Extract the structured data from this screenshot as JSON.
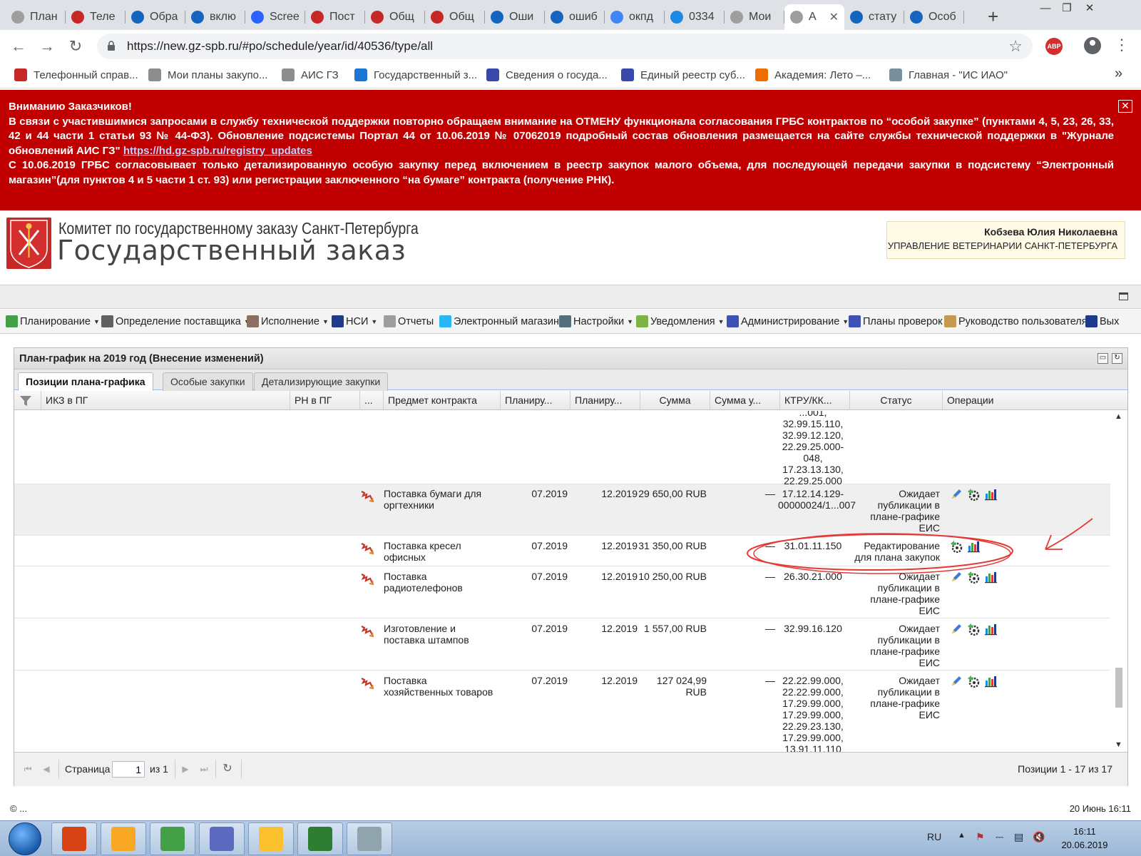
{
  "browser": {
    "tabs": [
      {
        "title": "План",
        "icon": "tools-icon",
        "color": "#9e9e9e"
      },
      {
        "title": "Теле",
        "icon": "emblem-icon",
        "color": "#c62828"
      },
      {
        "title": "Обра",
        "icon": "help-icon",
        "color": "#1565c0"
      },
      {
        "title": "вклю",
        "icon": "help-icon",
        "color": "#1565c0"
      },
      {
        "title": "Scree",
        "icon": "screenshot-icon",
        "color": "#2962ff"
      },
      {
        "title": "Пост",
        "icon": "flag-icon",
        "color": "#c62828"
      },
      {
        "title": "Общ",
        "icon": "flag-icon",
        "color": "#c62828"
      },
      {
        "title": "Общ",
        "icon": "flag-icon",
        "color": "#c62828"
      },
      {
        "title": "Оши",
        "icon": "help-icon",
        "color": "#1565c0"
      },
      {
        "title": "ошиб",
        "icon": "help-icon",
        "color": "#1565c0"
      },
      {
        "title": "окпд",
        "icon": "google-icon",
        "color": "#4285f4"
      },
      {
        "title": "0334",
        "icon": "pin-icon",
        "color": "#1e88e5"
      },
      {
        "title": "Мои",
        "icon": "tools-icon",
        "color": "#9e9e9e"
      },
      {
        "title": "А",
        "icon": "tools-icon",
        "color": "#9e9e9e",
        "active": true
      },
      {
        "title": "стату",
        "icon": "help-icon",
        "color": "#1565c0"
      },
      {
        "title": "Особ",
        "icon": "help-icon",
        "color": "#1565c0"
      }
    ],
    "url": "https://new.gz-spb.ru/#po/schedule/year/id/40536/type/all",
    "abp_label": "ABP",
    "bookmarks": [
      {
        "label": "Телефонный справ...",
        "color": "#c62828"
      },
      {
        "label": "Мои планы закупо...",
        "color": "#8d8d8d"
      },
      {
        "label": "АИС ГЗ",
        "color": "#8d8d8d"
      },
      {
        "label": "Государственный з...",
        "color": "#1976d2"
      },
      {
        "label": "Сведения о госуда...",
        "color": "#3949ab"
      },
      {
        "label": "Единый реестр суб...",
        "color": "#3949ab"
      },
      {
        "label": "Академия: Лето –...",
        "color": "#ef6c00"
      },
      {
        "label": "Главная - \"ИС ИАО\"",
        "color": "#78909c"
      }
    ]
  },
  "banner": {
    "heading": "Вниманию Заказчиков!",
    "p1_pre": "В связи с участившимися запросами в службу технической поддержки повторно обращаем внимание на ОТМЕНУ функционала согласования ГРБС контрактов по “особой закупке” (пунктами 4, 5, 23, 26, 33, 42 и 44 части 1 статьи 93 №  44-ФЗ). Обновление подсистемы Портал 44 от 10.06.2019 № 07062019 подробный состав обновления размещается на сайте службы технической поддержки в \"Журнале обновлений АИС ГЗ\" ",
    "p1_link": "https://hd.gz-spb.ru/registry_updates",
    "p2": "С 10.06.2019 ГРБС согласовывает только детализированную особую закупку перед включением в реестр закупок малого объема, для последующей передачи закупки в подсистему “Электронный магазин”(для пунктов 4 и 5 части 1 ст. 93) или регистрации заключенного “на бумаге” контракта  (получение РНК)."
  },
  "header": {
    "org_name": "Комитет по государственному заказу Санкт-Петербурга",
    "site_title": "Государственный заказ",
    "user_name": "Кобзева Юлия Николаевна",
    "user_org": "УПРАВЛЕНИЕ ВЕТЕРИНАРИИ САНКТ-ПЕТЕРБУРГА"
  },
  "nav": [
    {
      "label": "Планирование",
      "dropdown": true,
      "color": "#43a047"
    },
    {
      "label": "Определение поставщика",
      "dropdown": true,
      "color": "#616161"
    },
    {
      "label": "Исполнение",
      "dropdown": true,
      "color": "#8d6e63"
    },
    {
      "label": "НСИ",
      "dropdown": true,
      "color": "#1e3a8a"
    },
    {
      "label": "Отчеты",
      "dropdown": false,
      "color": "#9e9e9e"
    },
    {
      "label": "Электронный магазин",
      "dropdown": false,
      "color": "#29b6f6"
    },
    {
      "label": "Настройки",
      "dropdown": true,
      "color": "#546e7a"
    },
    {
      "label": "Уведомления",
      "dropdown": true,
      "color": "#7cb342"
    },
    {
      "label": "Администрирование",
      "dropdown": true,
      "color": "#3f51b5"
    },
    {
      "label": "Планы проверок",
      "dropdown": false,
      "color": "#3f51b5"
    },
    {
      "label": "Руководство пользователя",
      "dropdown": false,
      "color": "#c49a52"
    },
    {
      "label": "Вых",
      "dropdown": false,
      "color": "#1e3a8a"
    }
  ],
  "panel": {
    "title": "План-график на 2019 год (Внесение изменений)",
    "tabs": [
      "Позиции плана-графика",
      "Особые закупки",
      "Детализирующие закупки"
    ],
    "columns": [
      "ИКЗ в ПГ",
      "РН в ПГ",
      "...",
      "Предмет контракта",
      "Планиру...",
      "Планиру...",
      "Сумма",
      "Сумма у...",
      "КТРУ/КК...",
      "Статус",
      "Операции"
    ],
    "partial_row": {
      "ktru": "...001,\n32.99.15.110,\n32.99.12.120,\n22.29.25.000-\n048,\n17.23.13.130,\n22.29.25.000"
    },
    "rows": [
      {
        "subject": "Поставка бумаги для оргтехники",
        "p1": "07.2019",
        "p2": "12.2019",
        "sum": "29 650,00 RUB",
        "sum_u": "—",
        "ktru": "17.12.14.129-00000024/1...007",
        "status": "Ожидает публикации в плане-графике ЕИС",
        "ops": [
          "edit",
          "settings",
          "chart"
        ],
        "selected": true
      },
      {
        "subject": "Поставка кресел офисных",
        "p1": "07.2019",
        "p2": "12.2019",
        "sum": "31 350,00 RUB",
        "sum_u": "—",
        "ktru": "31.01.11.150",
        "status": "Редактирование для плана закупок",
        "ops": [
          "settings",
          "chart"
        ],
        "selected": false
      },
      {
        "subject": "Поставка радиотелефонов",
        "p1": "07.2019",
        "p2": "12.2019",
        "sum": "10 250,00 RUB",
        "sum_u": "—",
        "ktru": "26.30.21.000",
        "status": "Ожидает публикации в плане-графике ЕИС",
        "ops": [
          "edit",
          "settings",
          "chart"
        ],
        "selected": false
      },
      {
        "subject": "Изготовление и поставка штампов",
        "p1": "07.2019",
        "p2": "12.2019",
        "sum": "1 557,00 RUB",
        "sum_u": "—",
        "ktru": "32.99.16.120",
        "status": "Ожидает публикации в плане-графике ЕИС",
        "ops": [
          "edit",
          "settings",
          "chart"
        ],
        "selected": false
      },
      {
        "subject": "Поставка хозяйственных товаров",
        "p1": "07.2019",
        "p2": "12.2019",
        "sum": "127 024,99 RUB",
        "sum_u": "—",
        "ktru": "22.22.99.000,\n22.22.99.000,\n17.29.99.000,\n17.29.99.000,\n22.29.23.130,\n17.29.99.000,\n13.91.11.110",
        "status": "Ожидает публикации в плане-графике ЕИС",
        "ops": [
          "edit",
          "settings",
          "chart"
        ],
        "selected": false
      }
    ],
    "pager": {
      "page_label": "Страница",
      "page_value": "1",
      "of_label": "из 1",
      "info": "Позиции 1 - 17 из 17"
    }
  },
  "footer": {
    "left": "© ...",
    "right": "20 Июнь 16:11"
  },
  "taskbar": {
    "apps": [
      {
        "name": "ccleaner-app",
        "color": "#d84315"
      },
      {
        "name": "mail-app",
        "color": "#f9a825"
      },
      {
        "name": "chrome-app",
        "color": "#43a047"
      },
      {
        "name": "calendar-app",
        "color": "#5c6bc0"
      },
      {
        "name": "explorer-app",
        "color": "#fbc02d"
      },
      {
        "name": "excel-app",
        "color": "#2e7d32"
      },
      {
        "name": "calculator-app",
        "color": "#90a4ae"
      }
    ],
    "lang": "RU",
    "time": "16:11",
    "date": "20.06.2019"
  },
  "colors": {
    "banner_bg": "#c00000",
    "annotation": "#e53935"
  }
}
